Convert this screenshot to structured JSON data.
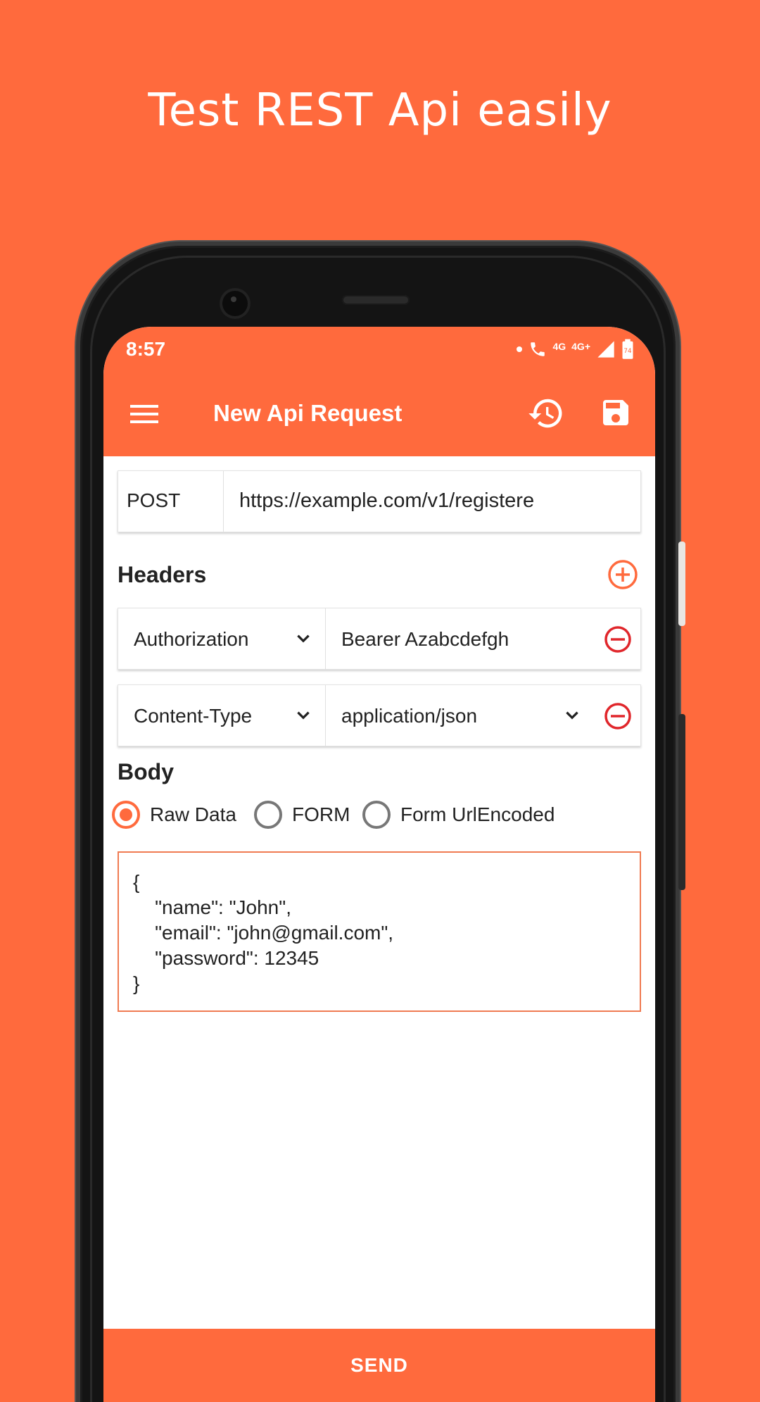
{
  "promo": {
    "title": "Test REST Api easily"
  },
  "status_bar": {
    "time": "8:57",
    "network_1": "4G",
    "network_2": "4G+",
    "battery": "74"
  },
  "app_bar": {
    "title": "New Api Request"
  },
  "request": {
    "method": "POST",
    "url": "https://example.com/v1/registere"
  },
  "headers_section": {
    "title": "Headers",
    "rows": [
      {
        "key": "Authorization",
        "value": "Bearer Azabcdefgh"
      },
      {
        "key": "Content-Type",
        "value": "application/json"
      }
    ]
  },
  "body_section": {
    "title": "Body",
    "options": [
      "Raw Data",
      "FORM",
      "Form UrlEncoded"
    ],
    "selected": "Raw Data",
    "content": "{\n    \"name\": \"John\",\n    \"email\": \"john@gmail.com\",\n    \"password\": 12345\n}"
  },
  "send_button": {
    "label": "SEND"
  },
  "colors": {
    "accent": "#FF6A3D",
    "remove": "#E0262B",
    "frame": "#141414"
  },
  "icons": [
    "menu-icon",
    "history-icon",
    "save-icon",
    "add-circle-icon",
    "remove-circle-icon",
    "chevron-down-icon"
  ]
}
